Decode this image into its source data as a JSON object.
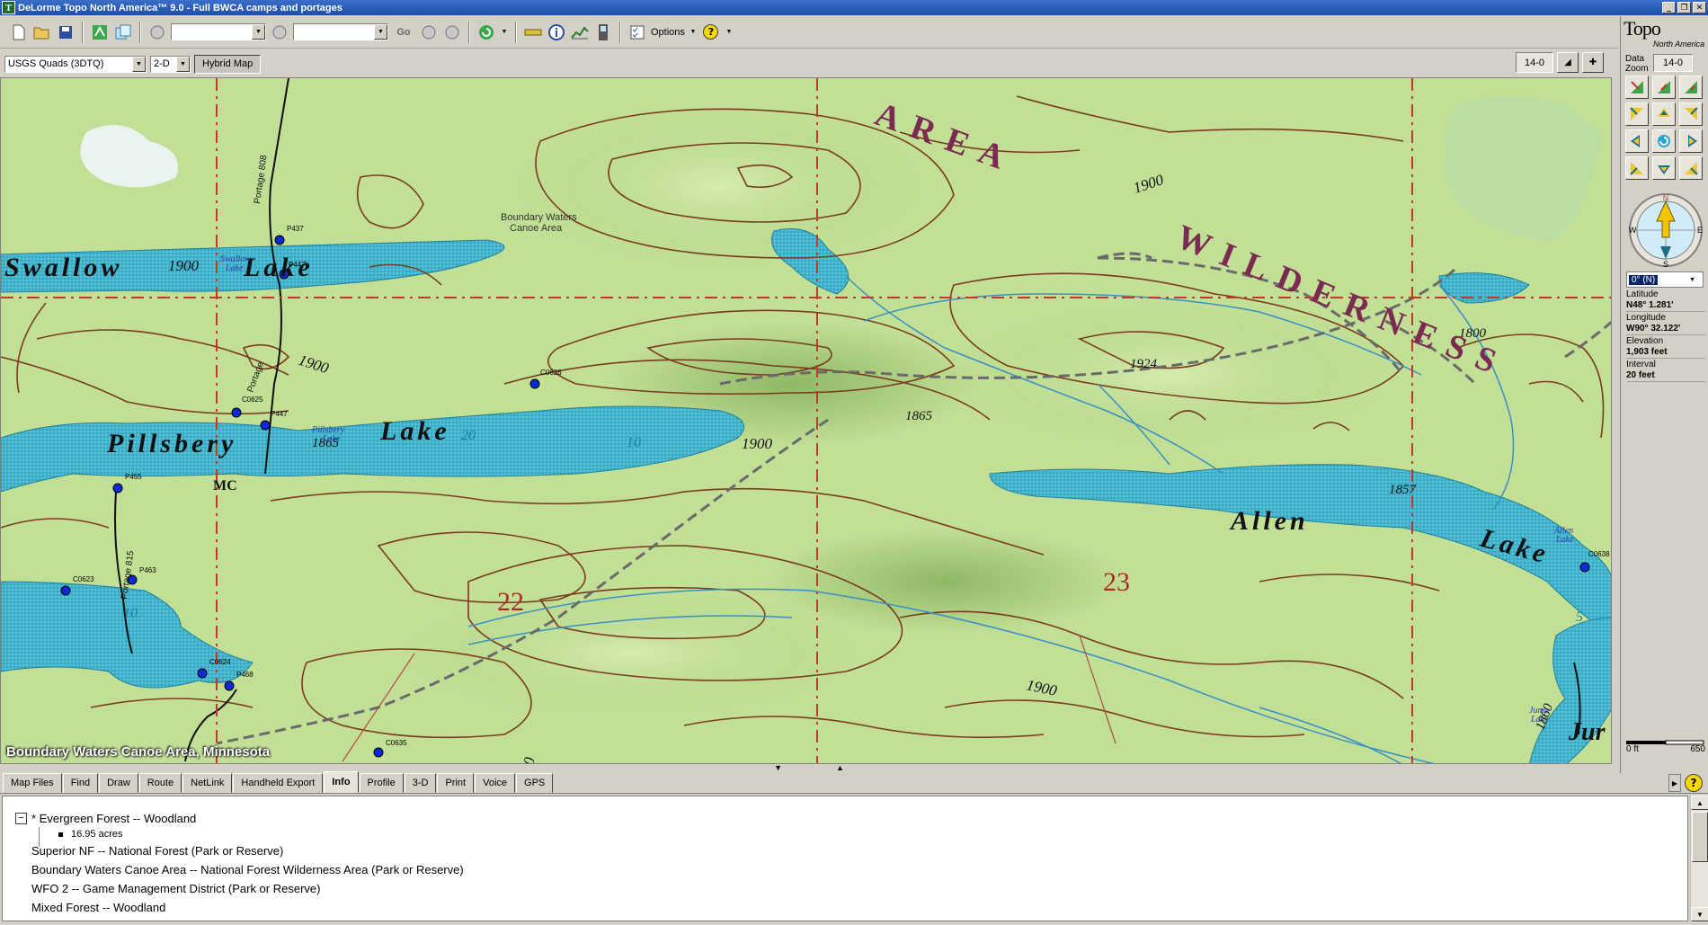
{
  "window": {
    "title": "DeLorme Topo North America™ 9.0 - Full BWCA camps and portages",
    "icon_letter": "T",
    "minimize": "_",
    "restore": "❐",
    "close": "✕"
  },
  "toolbar": {
    "icons": [
      "new-file-icon",
      "open-folder-icon",
      "save-icon",
      "map-layers-icon",
      "copy-icon"
    ],
    "combo1_value": "",
    "combo2_value": "",
    "go_label": "Go",
    "options_label": "Options",
    "help_glyph": "?"
  },
  "toolbar2": {
    "map_type": "USGS Quads (3DTQ)",
    "view_mode": "2-D",
    "hybrid_label": "Hybrid Map",
    "zoom_value": "14-0"
  },
  "map": {
    "caption": "Boundary Waters Canoe Area, Minnesota",
    "labels": {
      "area": "AREA",
      "wilderness": "WILDERNESS",
      "swallow": "Swallow",
      "lake1": "Lake",
      "pillsbery": "Pillsbery",
      "lake2": "Lake",
      "allen": "Allen",
      "lake3": "Lake",
      "jun": "Jur",
      "bwca_label_1": "Boundary Waters",
      "bwca_label_2": "Canoe Area",
      "mc": "MC",
      "section22": "22",
      "section23": "23",
      "e1900a": "1900",
      "e1900b": "1900",
      "e1900c": "1900",
      "e1900d": "1900",
      "e1900e": "1900",
      "e1900f": "1900",
      "e1865": "1865",
      "e1924": "1924",
      "e1857": "1857",
      "e1800": "1800",
      "e1860": "1860",
      "d20": "20",
      "d10a": "10",
      "d10b": "10",
      "d5": "5",
      "portage808": "Portage 808",
      "portage815": "Portage 815",
      "portage": "Portage",
      "swallow_small_1": "Swallow",
      "swallow_small_2": "Lake",
      "pillsbery_small_1": "Pillsbery",
      "pillsbery_small_2": "Lake",
      "allen_small_1": "Allen",
      "allen_small_2": "Lake",
      "jump_small_1": "Jump",
      "jump_small_2": "Lake"
    },
    "points": [
      {
        "id": "P437",
        "label": "P437"
      },
      {
        "id": "P447b",
        "label": "P447b"
      },
      {
        "id": "C0626",
        "label": "C0626"
      },
      {
        "id": "C0625",
        "label": "C0625"
      },
      {
        "id": "P447",
        "label": "P447"
      },
      {
        "id": "P455",
        "label": "P455"
      },
      {
        "id": "C0623",
        "label": "C0623"
      },
      {
        "id": "C0624",
        "label": "C0624"
      },
      {
        "id": "P468",
        "label": "P468"
      },
      {
        "id": "C0635",
        "label": "C0635"
      },
      {
        "id": "C0638",
        "label": "C0638"
      },
      {
        "id": "P463",
        "label": "P463"
      }
    ],
    "colors": {
      "land": "#c2df96",
      "water": "#3fb3cc",
      "contour": "#7a3b1e",
      "grid": "#c0392b",
      "label": "#7b2a52"
    }
  },
  "right_panel": {
    "logo": "Topo",
    "logo_sub": "North America",
    "data_zoom_label_1": "Data",
    "data_zoom_label_2": "Zoom",
    "data_zoom_value": "14-0",
    "rotation": "0° (N)",
    "compass": {
      "n": "N",
      "s": "S",
      "e": "E",
      "w": "W"
    },
    "latitude_label": "Latitude",
    "latitude_value": "N48° 1.281'",
    "longitude_label": "Longitude",
    "longitude_value": "W90° 32.122'",
    "elevation_label": "Elevation",
    "elevation_value": "1,903 feet",
    "interval_label": "Interval",
    "interval_value": "20 feet",
    "scale_start": "0 ft",
    "scale_end": "650"
  },
  "tabs": [
    {
      "label": "Map Files"
    },
    {
      "label": "Find"
    },
    {
      "label": "Draw"
    },
    {
      "label": "Route"
    },
    {
      "label": "NetLink"
    },
    {
      "label": "Handheld Export"
    },
    {
      "label": "Info",
      "active": true
    },
    {
      "label": "Profile"
    },
    {
      "label": "3-D"
    },
    {
      "label": "Print"
    },
    {
      "label": "Voice"
    },
    {
      "label": "GPS"
    }
  ],
  "info": {
    "expanded_item": "* Evergreen Forest -- Woodland",
    "expanded_sub": "16.95 acres",
    "rows": [
      "Superior NF -- National Forest (Park or Reserve)",
      "Boundary Waters Canoe Area -- National Forest Wilderness Area (Park or Reserve)",
      "WFO 2 -- Game Management District (Park or Reserve)",
      "Mixed Forest -- Woodland"
    ]
  }
}
